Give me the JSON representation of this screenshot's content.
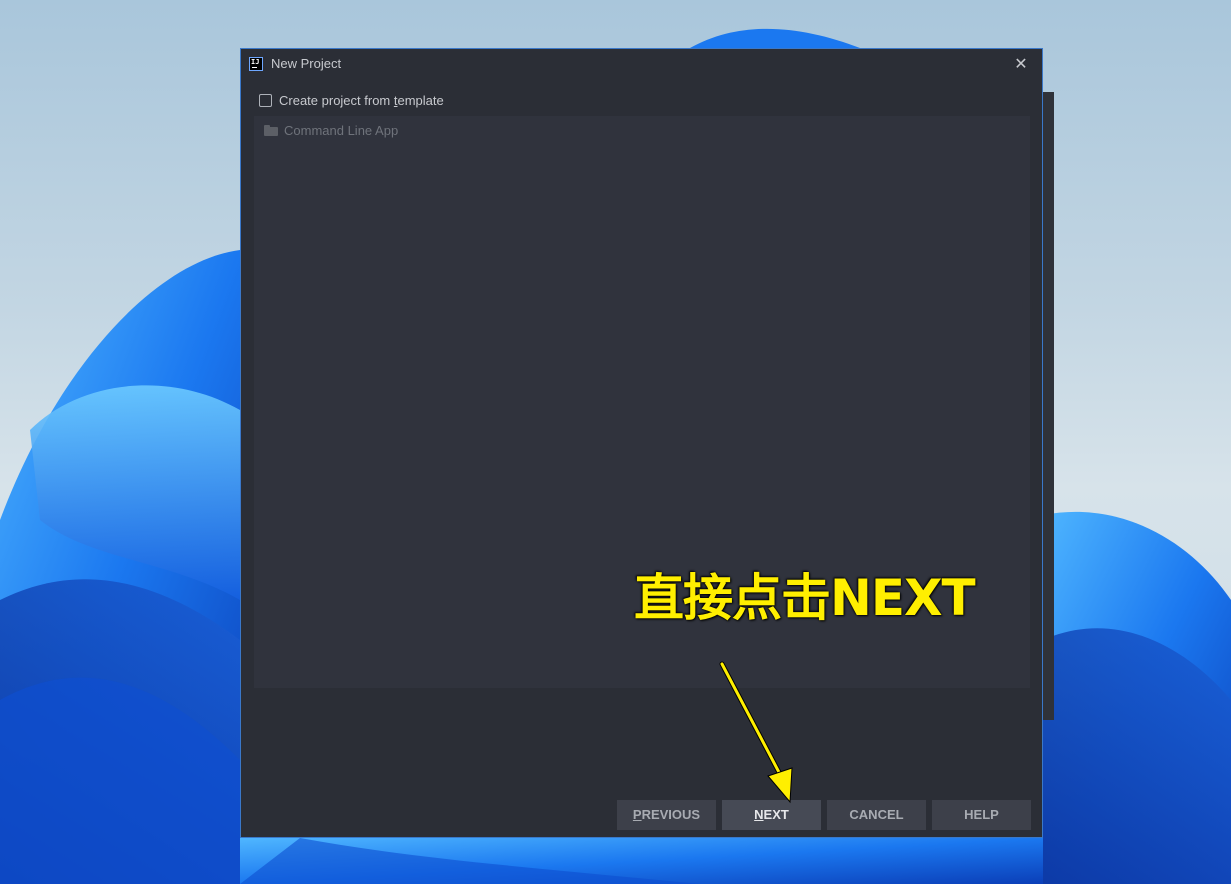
{
  "dialog": {
    "title": "New Project",
    "close_symbol": "✕",
    "app_icon_text": "IJ",
    "template_checkbox": {
      "label_before": "Create project from ",
      "label_mnemonic": "t",
      "label_after": "emplate",
      "checked": false
    },
    "template_list": [
      {
        "icon": "folder-icon",
        "label": "Command Line App"
      }
    ],
    "buttons": {
      "previous": {
        "mnemonic": "P",
        "rest": "REVIOUS"
      },
      "next": {
        "mnemonic": "N",
        "rest": "EXT"
      },
      "cancel": "CANCEL",
      "help": "HELP"
    }
  },
  "annotation": {
    "text": "直接点击NEXT",
    "color": "#ffef00"
  },
  "colors": {
    "dialog_bg": "#2b2e36",
    "panel_bg": "#30333d",
    "border_accent": "#3a78c9",
    "desktop_blue": "#1a6ee6"
  }
}
